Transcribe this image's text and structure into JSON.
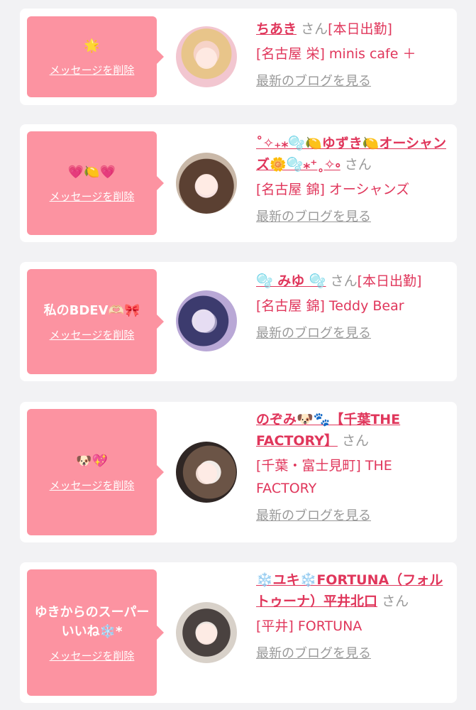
{
  "delete_label": "メッセージを削除",
  "blog_label": "最新のブログを見る",
  "suffix_label": "さん",
  "colors": {
    "accent": "#e0365b",
    "message_bg": "#fc93a1",
    "muted": "#999999"
  },
  "cards": [
    {
      "message": "🌟",
      "name": "ちあき",
      "badge": "[本日出勤]",
      "shop": "[名古屋 栄] minis cafe ＋"
    },
    {
      "message": "💗🍋💗",
      "name": "˚✧₊⁎🫧🍋ゆずき🍋オーシャンズ🌼🫧⁎⁺˳✧༚",
      "badge": "",
      "shop": "[名古屋 錦] オーシャンズ"
    },
    {
      "message": "私のBDEV🫶🏻🎀",
      "name": "🫧 みゆ 🫧",
      "badge": "[本日出勤]",
      "shop": "[名古屋 錦] Teddy Bear"
    },
    {
      "message": "🐶💖",
      "name": "のぞみ🐶🐾【千葉THE FACTORY】",
      "badge": "",
      "shop": "[千葉・富士見町] THE FACTORY"
    },
    {
      "message": "ゆきからのスーパーいいね❄️*",
      "name": "❄️ユキ❄️FORTUNA（フォルトゥーナ）平井北口",
      "badge": "",
      "shop": "[平井] FORTUNA"
    }
  ]
}
